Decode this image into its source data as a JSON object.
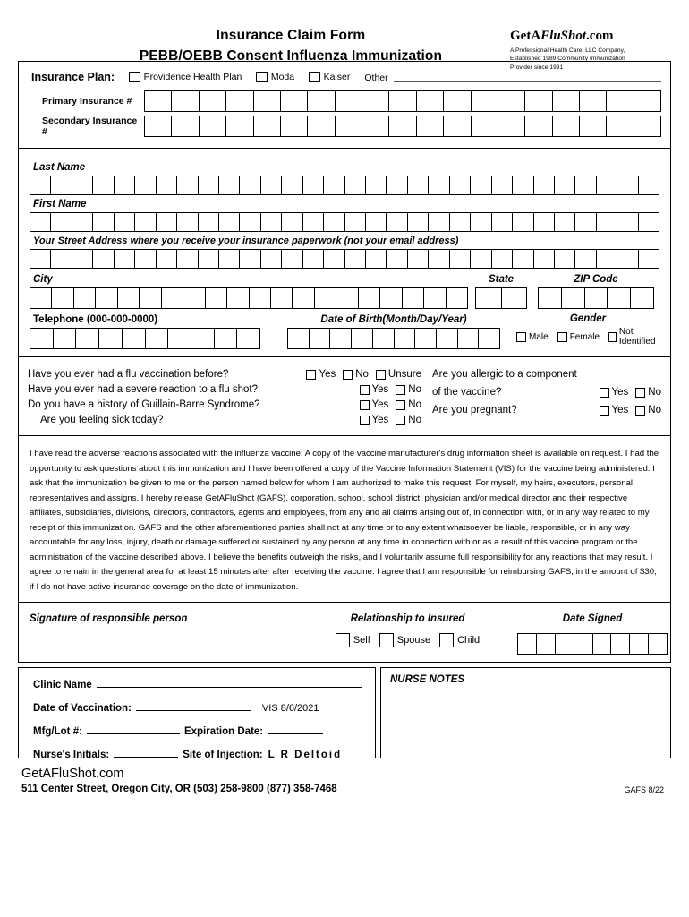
{
  "header": {
    "title_line1": "Insurance Claim Form",
    "title_line2": "PEBB/OEBB Consent Influenza Immunization",
    "logo_prefix": "Get",
    "logo_a": "A",
    "logo_italic": "FluShot",
    "logo_suffix": ".com",
    "logo_tagline_1": "A Professional Health Care, LLC Company,",
    "logo_tagline_2": "Established 1989 Community Immunization",
    "logo_tagline_3": "Provider since 1991"
  },
  "insurance": {
    "plan_label": "Insurance Plan:",
    "options": [
      "Providence Health Plan",
      "Moda",
      "Kaiser"
    ],
    "other_label": "Other",
    "primary_label": "Primary Insurance #",
    "secondary_label": "Secondary Insurance #",
    "primary_box_count": 19,
    "secondary_box_count": 19
  },
  "identity": {
    "last_name_label": "Last Name",
    "last_name_boxes": 30,
    "first_name_label": "First Name",
    "first_name_boxes": 30,
    "street_label": "Your Street Address where you receive your insurance paperwork (not your email address)",
    "street_boxes": 30,
    "city_label": "City",
    "city_boxes": 20,
    "state_label": "State",
    "state_boxes": 2,
    "zip_label": "ZIP Code",
    "zip_boxes": 5,
    "telephone_label": "Telephone (000-000-0000)",
    "telephone_boxes": 10,
    "dob_label": "Date of Birth(Month/Day/Year)",
    "dob_boxes": 10,
    "gender_label": "Gender",
    "gender_options": [
      "Male",
      "Female",
      "Not Identified"
    ]
  },
  "questions": {
    "left": [
      {
        "text": "Have you ever had a flu vaccination before?",
        "options": [
          "Yes",
          "No",
          "Unsure"
        ]
      },
      {
        "text": "Have you ever had a severe reaction to a flu shot?",
        "options": [
          "Yes",
          "No"
        ]
      },
      {
        "text": "Do you have a history of Guillain-Barre Syndrome?",
        "options": [
          "Yes",
          "No"
        ]
      },
      {
        "text": "Are you feeling sick today?",
        "options": [
          "Yes",
          "No"
        ]
      }
    ],
    "right": [
      {
        "text_line1": "Are you allergic to a component",
        "text_line2": "of the vaccine?",
        "options": [
          "Yes",
          "No"
        ]
      },
      {
        "text_line1": "Are you pregnant?",
        "text_line2": "",
        "options": [
          "Yes",
          "No"
        ]
      }
    ]
  },
  "consent": {
    "text": "I have read the adverse reactions associated with the influenza vaccine. A copy of the vaccine manufacturer's drug information sheet is available on request. I had the opportunity to ask questions about this immunization and I have been offered a copy of the Vaccine Information Statement (VIS) for the vaccine being administered. I ask that the immunization be given to me or the person named below for whom I am authorized to make this request. For myself, my heirs, executors, personal representatives and assigns, I hereby release GetAFluShot (GAFS), corporation, school, school district, physician and/or medical director and their respective affiliates, subsidiaries, divisions, directors, contractors, agents and employees, from any and all claims arising out of, in connection with, or in any way related to my receipt of this immunization. GAFS and the other aforementioned parties shall not at any time or to any extent whatsoever be liable, responsible, or in any way accountable for any loss, injury, death or damage suffered or sustained by any person at any time in connection with or as a result of this vaccine program or the administration of the vaccine described above. I believe the benefits outweigh the risks, and I voluntarily assume full responsibility for any reactions that may result. I agree to remain in the general area for at least 15 minutes after after receiving the vaccine. I agree that I am responsible for reimbursing GAFS, in the amount of $30, if I do not have active insurance coverage on the date of immunization."
  },
  "signature": {
    "signature_label": "Signature of responsible person",
    "relationship_label": "Relationship to Insured",
    "relationship_options": [
      "Self",
      "Spouse",
      "Child"
    ],
    "date_signed_label": "Date Signed",
    "date_signed_boxes": 8
  },
  "clinic": {
    "clinic_name_label": "Clinic Name",
    "date_of_vaccination_label": "Date of Vaccination:",
    "vis_text": "VIS 8/6/2021",
    "mfg_lot_label": "Mfg/Lot #:",
    "expiration_label": "Expiration Date:",
    "nurse_initials_label": "Nurse's Initials:",
    "site_of_injection_label": "Site of Injection:",
    "injection_options": "L  R  Deltoid",
    "nurse_notes_label": "NURSE NOTES"
  },
  "footer": {
    "logo_prefix": "Get",
    "logo_a": "A",
    "logo_italic": "FluShot",
    "logo_suffix": ".com",
    "address": "511 Center Street, Oregon City, OR",
    "phone1": "(503) 258-9800",
    "phone2": "(877) 358-7468",
    "form_code": "GAFS 8/22"
  }
}
